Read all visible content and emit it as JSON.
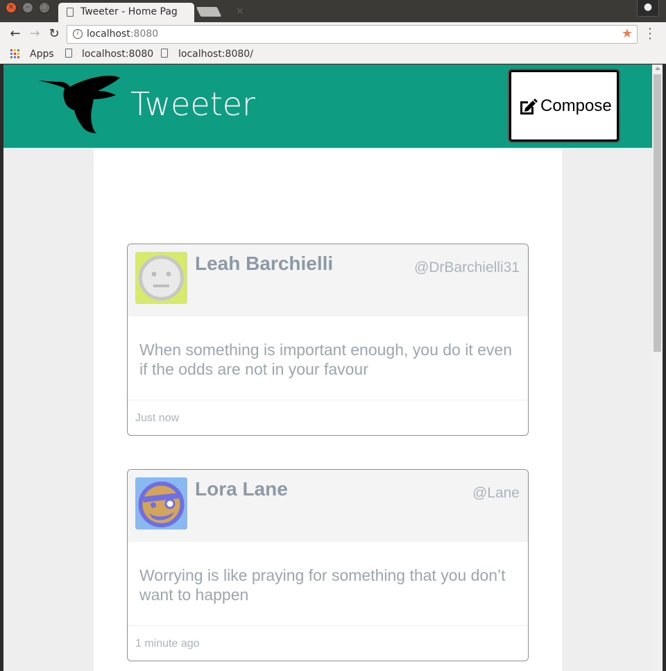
{
  "browser": {
    "tab_title": "Tweeter - Home Pag",
    "tab_close": "×",
    "url_host": "localhost",
    "url_port": ":8080",
    "bookmarks": [
      {
        "label": "Apps"
      },
      {
        "label": "localhost:8080"
      },
      {
        "label": "localhost:8080/"
      }
    ]
  },
  "app": {
    "brand": "Tweeter",
    "compose_label": "Compose",
    "accent_color": "#0e9d82"
  },
  "tweets": [
    {
      "name": "Leah Barchielli",
      "handle": "@DrBarchielli31",
      "content": "When something is important enough, you do it even if the odds are not in your favour",
      "time": "Just now",
      "avatar_icon": "neutral-face-avatar-icon"
    },
    {
      "name": "Lora Lane",
      "handle": "@Lane",
      "content": "Worrying is like praying for something that you don’t want to happen",
      "time": "1 minute ago",
      "avatar_icon": "pirate-face-avatar-icon"
    }
  ]
}
